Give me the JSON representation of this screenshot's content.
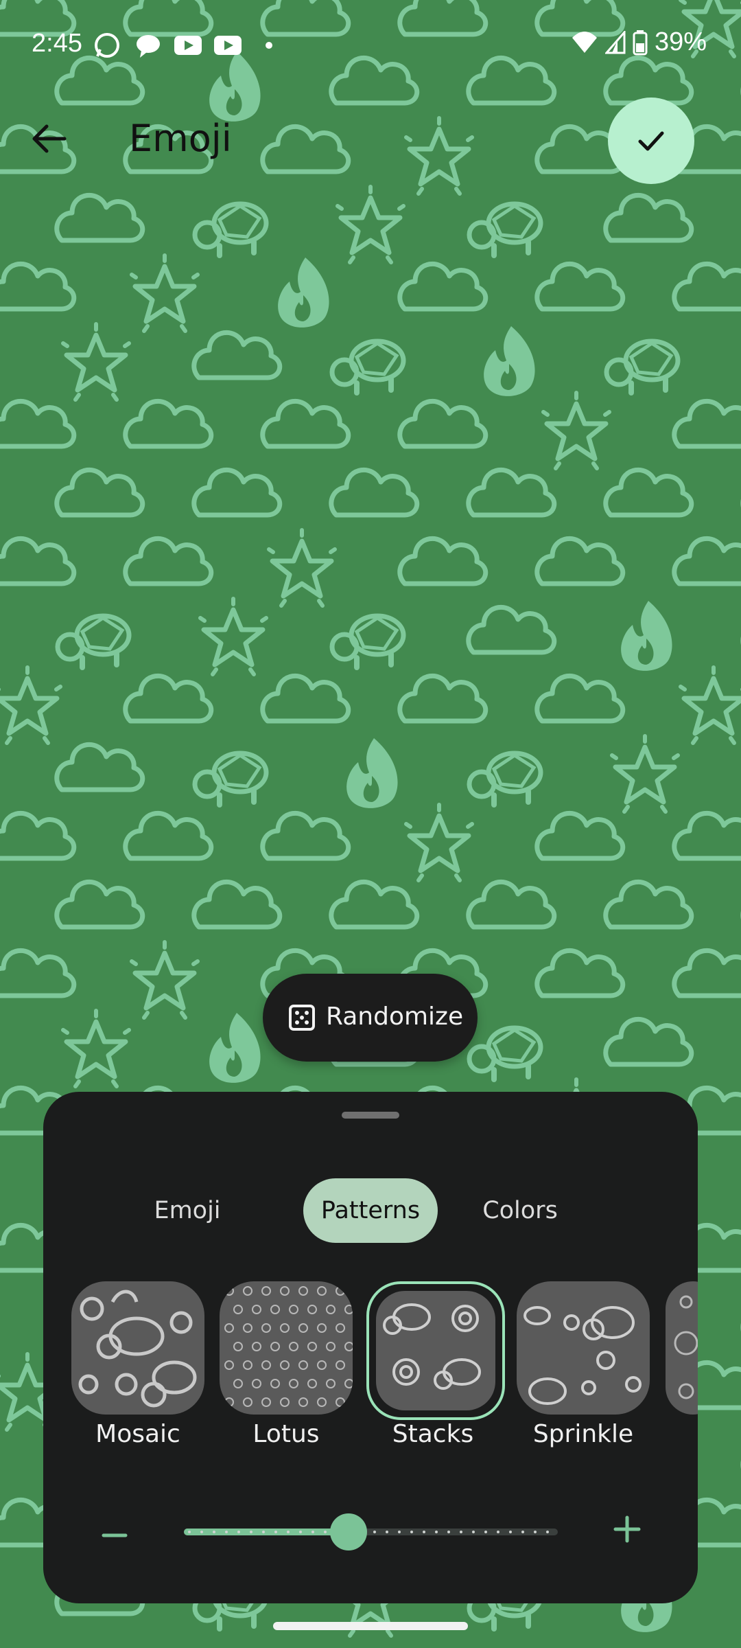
{
  "status_bar": {
    "time": "2:45",
    "battery_percent": "39%",
    "notification_icons": [
      "whatsapp-icon",
      "messages-icon",
      "youtube-icon",
      "youtube-icon",
      "dot-icon"
    ],
    "system_icons": [
      "wifi-icon",
      "signal-icon",
      "battery-icon"
    ]
  },
  "header": {
    "title": "Emoji",
    "back_icon": "arrow-back-icon",
    "confirm_icon": "checkmark-icon"
  },
  "randomize": {
    "label": "Randomize",
    "icon": "dice-icon"
  },
  "sheet": {
    "tabs": [
      {
        "label": "Emoji",
        "selected": false
      },
      {
        "label": "Patterns",
        "selected": true
      },
      {
        "label": "Colors",
        "selected": false
      }
    ],
    "patterns": [
      {
        "label": "Mosaic",
        "selected": false
      },
      {
        "label": "Lotus",
        "selected": false
      },
      {
        "label": "Stacks",
        "selected": true
      },
      {
        "label": "Sprinkle",
        "selected": false
      }
    ],
    "density_slider": {
      "value_fraction": 0.44,
      "minus_icon": "minus-icon",
      "plus_icon": "plus-icon"
    }
  },
  "colors": {
    "background": "#428a4f",
    "pattern": "#7ec89a",
    "sheet": "#1b1c1c",
    "accent": "#b7f0cf",
    "selected_tab": "#b3d4bc",
    "slider": "#7bc397"
  }
}
